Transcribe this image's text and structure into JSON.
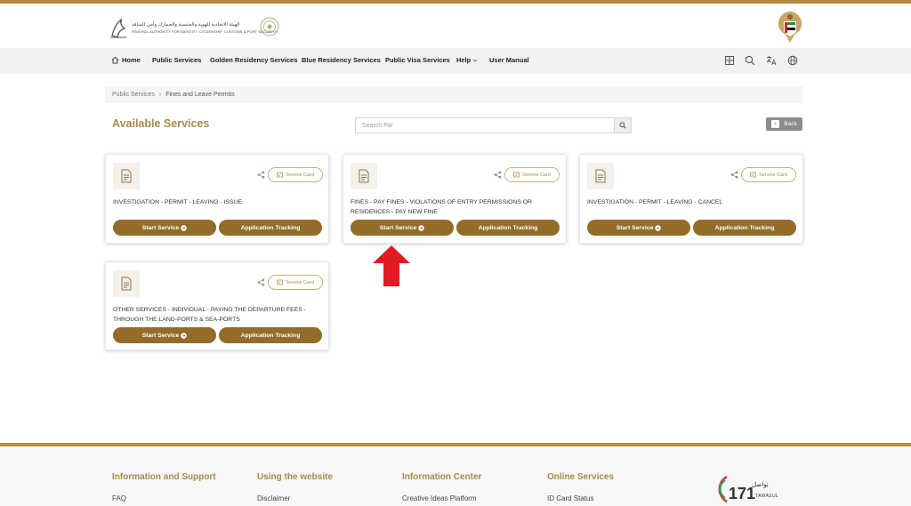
{
  "header": {
    "logo_ar": "الهيئة الاتحادية للهوية والجنسية والجمارك وأمن المنافذ",
    "logo_en": "FEDERAL AUTHORITY FOR IDENTITY, CITIZENSHIP, CUSTOMS & PORT SECURITY"
  },
  "nav": {
    "home": "Home",
    "public_services": "Public Services",
    "golden_residency": "Golden Residency Services",
    "blue_residency": "Blue Residency Services",
    "public_visa": "Public Visa Services",
    "help": "Help",
    "user_manual": "User Manual"
  },
  "breadcrumb": {
    "parent": "Public Services",
    "separator": "›",
    "current": "Fines and Leave Permits"
  },
  "page": {
    "title": "Available Services",
    "search_placeholder": "Search For",
    "back_label": "Back"
  },
  "cards": [
    {
      "service_card_label": "Service Card",
      "description": "INVESTIGATION - PERMIT - LEAVING - ISSUE",
      "start_label": "Start Service",
      "tracking_label": "Application Tracking"
    },
    {
      "service_card_label": "Service Card",
      "description": "FINES - PAY FINES - VIOLATIONS OF ENTRY PERMISSIONS OR RESIDENCES - PAY NEW FINE",
      "start_label": "Start Service",
      "tracking_label": "Application Tracking"
    },
    {
      "service_card_label": "Service Card",
      "description": "INVESTIGATION - PERMIT - LEAVING - CANCEL",
      "start_label": "Start Service",
      "tracking_label": "Application Tracking"
    },
    {
      "service_card_label": "Service Card",
      "description": "OTHER SERVICES - INDIVIDUAL - PAYING THE DEPARTURE FEES - THROUGH THE LAND-PORTS & SEA-PORTS",
      "start_label": "Start Service",
      "tracking_label": "Application Tracking"
    }
  ],
  "footer": {
    "columns": [
      {
        "heading": "Information and Support",
        "link": "FAQ"
      },
      {
        "heading": "Using the website",
        "link": "Disclaimer"
      },
      {
        "heading": "Information Center",
        "link": "Creative Ideas Platform"
      },
      {
        "heading": "Online Services",
        "link": "ID Card Status"
      }
    ],
    "tawasul_number": "171",
    "tawasul_ar": "تواصل",
    "tawasul_en": "TAWASUL"
  },
  "colors": {
    "gold": "#b58a3b",
    "button_brown": "#936c2a",
    "title_gold": "#a88a4a",
    "arrow_red": "#e21b23"
  },
  "icons": [
    "home-icon",
    "chevron-down-icon",
    "grid-icon",
    "search-icon",
    "translate-icon",
    "globe-icon",
    "document-icon",
    "share-icon",
    "card-icon",
    "arrow-circle-right-icon",
    "arrow-left-icon"
  ]
}
